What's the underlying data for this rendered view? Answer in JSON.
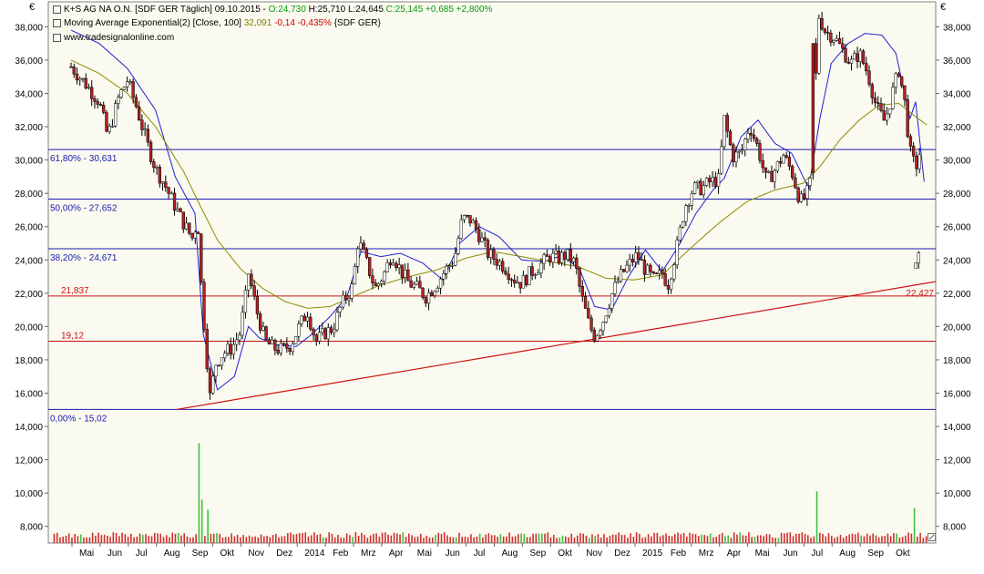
{
  "header": {
    "line1_instrument": "K+S AG NA O.N. [SDF GER  Täglich] 09.10.2015 - ",
    "line1_open": "O:24,730",
    "line1_high": "H:25,710",
    "line1_low": "L:24,645",
    "line1_close": "C:25,145 +0,685 +2,800%",
    "line2_name": "Moving Average Exponential(2) [Close, 100]",
    "line2_value": "32,091",
    "line2_change": "-0,14 -0,435%",
    "line2_source": "{SDF GER}",
    "line3": "www.tradesignalonline.com"
  },
  "currency_symbol": "€",
  "colors": {
    "background": "#fafaf0",
    "candle_up": "#ffffff",
    "candle_down": "#b22222",
    "bollinger": "#1f1fd6",
    "moving_average": "#8b8b00",
    "fibonacci": "#1a1ab0",
    "support": "#cc1111",
    "volume": "#d03030",
    "volume_green": "#40c040"
  },
  "chart_data": {
    "type": "candlestick",
    "series_info": "K+S AG NA O.N. daily",
    "ylim": [
      7000,
      39500
    ],
    "y_ticks": [
      "38,000",
      "36,000",
      "34,000",
      "32,000",
      "30,000",
      "28,000",
      "26,000",
      "24,000",
      "22,000",
      "20,000",
      "18,000",
      "16,000",
      "14,000",
      "12,000",
      "10,000",
      "8,000"
    ],
    "y_tick_values": [
      38,
      36,
      34,
      32,
      30,
      28,
      26,
      24,
      22,
      20,
      18,
      16,
      14,
      12,
      10,
      8
    ],
    "x_labels": [
      "Mai",
      "Jun",
      "Jul",
      "Aug",
      "Sep",
      "Okt",
      "Nov",
      "Dez",
      "2014",
      "Feb",
      "Mrz",
      "Apr",
      "Mai",
      "Jun",
      "Jul",
      "Aug",
      "Sep",
      "Okt",
      "Nov",
      "Dez",
      "2015",
      "Feb",
      "Mrz",
      "Apr",
      "Mai",
      "Jun",
      "Jul",
      "Aug",
      "Sep",
      "Okt"
    ],
    "fibonacci_levels": [
      {
        "label": "61,80% - 30,631",
        "value": 30.631
      },
      {
        "label": "50,00% - 27,652",
        "value": 27.652
      },
      {
        "label": "38,20% - 24,671",
        "value": 24.671
      },
      {
        "label": "0,00% - 15,02",
        "value": 15.02
      }
    ],
    "support_levels": [
      {
        "label": "21,837",
        "value": 21.837
      },
      {
        "label": "19,12",
        "value": 19.12
      }
    ],
    "trendline": {
      "start_month": 3.75,
      "start_value": 15.02,
      "end_month": 30.2,
      "end_value": 22.7,
      "label": "22,427"
    },
    "price_path": [
      [
        0,
        35.6
      ],
      [
        0.5,
        34.6
      ],
      [
        1,
        33.5
      ],
      [
        1.3,
        31.4
      ],
      [
        1.7,
        33.8
      ],
      [
        2,
        34.8
      ],
      [
        2.3,
        33.3
      ],
      [
        2.7,
        31.0
      ],
      [
        3.0,
        29.5
      ],
      [
        3.3,
        28.6
      ],
      [
        3.7,
        27.2
      ],
      [
        4.0,
        26.2
      ],
      [
        4.3,
        25.3
      ],
      [
        4.5,
        26.4
      ],
      [
        4.6,
        23.0
      ],
      [
        4.8,
        18.5
      ],
      [
        4.95,
        15.5
      ],
      [
        5.1,
        17.7
      ],
      [
        5.4,
        18.4
      ],
      [
        5.7,
        18.7
      ],
      [
        6.0,
        19.6
      ],
      [
        6.2,
        21.8
      ],
      [
        6.3,
        23.2
      ],
      [
        6.6,
        20.9
      ],
      [
        6.9,
        19.1
      ],
      [
        7.2,
        18.7
      ],
      [
        7.5,
        18.6
      ],
      [
        7.8,
        18.9
      ],
      [
        8.1,
        20.0
      ],
      [
        8.4,
        20.9
      ],
      [
        8.7,
        19.1
      ],
      [
        9.0,
        19.6
      ],
      [
        9.3,
        19.9
      ],
      [
        9.6,
        21.3
      ],
      [
        10.0,
        22.4
      ],
      [
        10.2,
        25.2
      ],
      [
        10.5,
        23.8
      ],
      [
        10.8,
        22.3
      ],
      [
        11.1,
        23.1
      ],
      [
        11.4,
        24.4
      ],
      [
        11.7,
        23.4
      ],
      [
        12.0,
        22.6
      ],
      [
        12.3,
        22.3
      ],
      [
        12.6,
        21.8
      ],
      [
        13.0,
        22.6
      ],
      [
        13.3,
        23.4
      ],
      [
        13.6,
        24.0
      ],
      [
        13.9,
        26.5
      ],
      [
        14.2,
        26.4
      ],
      [
        14.5,
        25.5
      ],
      [
        14.8,
        24.4
      ],
      [
        15.1,
        24.0
      ],
      [
        15.4,
        23.6
      ],
      [
        15.7,
        22.9
      ],
      [
        16.0,
        22.6
      ],
      [
        16.3,
        23.2
      ],
      [
        16.6,
        23.6
      ],
      [
        17.0,
        24.2
      ],
      [
        17.3,
        24.1
      ],
      [
        17.6,
        24.3
      ],
      [
        17.9,
        23.8
      ],
      [
        18.1,
        22.0
      ],
      [
        18.4,
        20.1
      ],
      [
        18.6,
        19.4
      ],
      [
        18.9,
        20.4
      ],
      [
        19.2,
        21.9
      ],
      [
        19.5,
        23.0
      ],
      [
        19.8,
        23.7
      ],
      [
        20.1,
        24.3
      ],
      [
        20.4,
        23.4
      ],
      [
        20.7,
        22.8
      ],
      [
        21.0,
        23.2
      ],
      [
        21.2,
        22.5
      ],
      [
        21.5,
        24.6
      ],
      [
        21.8,
        27.2
      ],
      [
        22.1,
        28.3
      ],
      [
        22.4,
        28.3
      ],
      [
        22.7,
        28.7
      ],
      [
        23.0,
        28.8
      ],
      [
        23.2,
        32.5
      ],
      [
        23.5,
        30.2
      ],
      [
        23.8,
        30.4
      ],
      [
        24.1,
        32.1
      ],
      [
        24.4,
        30.7
      ],
      [
        24.7,
        28.7
      ],
      [
        25.0,
        29.4
      ],
      [
        25.3,
        30.3
      ],
      [
        25.6,
        29.3
      ],
      [
        25.9,
        27.5
      ],
      [
        26.1,
        27.8
      ],
      [
        26.4,
        29.3
      ],
      [
        26.5,
        38.9
      ],
      [
        26.8,
        37.7
      ],
      [
        27.1,
        37.4
      ],
      [
        27.4,
        36.6
      ],
      [
        27.7,
        35.8
      ],
      [
        28.0,
        36.4
      ],
      [
        28.3,
        35.2
      ],
      [
        28.6,
        33.2
      ],
      [
        28.9,
        32.3
      ],
      [
        29.2,
        34.2
      ],
      [
        29.4,
        35.4
      ],
      [
        29.6,
        33.6
      ],
      [
        29.8,
        30.5
      ],
      [
        30.0,
        29.5
      ],
      [
        30.2,
        30.8
      ]
    ],
    "gap_path": [
      [
        30.0,
        23.5
      ],
      [
        30.2,
        24.5
      ]
    ],
    "bollinger_path": [
      [
        0,
        37.8
      ],
      [
        1,
        37.0
      ],
      [
        2,
        35.5
      ],
      [
        3,
        33.0
      ],
      [
        3.7,
        29.0
      ],
      [
        4.4,
        26.8
      ],
      [
        4.7,
        19.5
      ],
      [
        5.2,
        16.2
      ],
      [
        5.8,
        17.0
      ],
      [
        6.3,
        20.0
      ],
      [
        6.7,
        19.3
      ],
      [
        7.3,
        18.9
      ],
      [
        8.0,
        18.8
      ],
      [
        8.6,
        19.6
      ],
      [
        9.2,
        20.6
      ],
      [
        9.8,
        21.8
      ],
      [
        10.3,
        24.5
      ],
      [
        11.0,
        24.2
      ],
      [
        11.7,
        24.4
      ],
      [
        12.5,
        23.8
      ],
      [
        13.2,
        22.8
      ],
      [
        13.8,
        25.0
      ],
      [
        14.5,
        26.0
      ],
      [
        15.2,
        25.4
      ],
      [
        16.0,
        24.0
      ],
      [
        16.8,
        23.9
      ],
      [
        17.5,
        24.3
      ],
      [
        18.1,
        23.3
      ],
      [
        18.6,
        21.2
      ],
      [
        19.2,
        21.0
      ],
      [
        19.8,
        23.0
      ],
      [
        20.4,
        24.6
      ],
      [
        21.0,
        23.3
      ],
      [
        21.6,
        24.9
      ],
      [
        22.2,
        26.8
      ],
      [
        22.8,
        28.2
      ],
      [
        23.2,
        28.9
      ],
      [
        23.8,
        31.4
      ],
      [
        24.4,
        32.4
      ],
      [
        25.0,
        31.0
      ],
      [
        25.6,
        30.4
      ],
      [
        26.2,
        28.3
      ],
      [
        26.6,
        32.5
      ],
      [
        27.0,
        35.8
      ],
      [
        27.6,
        37.0
      ],
      [
        28.2,
        37.6
      ],
      [
        28.8,
        37.5
      ],
      [
        29.3,
        36.4
      ],
      [
        29.8,
        32.5
      ],
      [
        30.0,
        33.5
      ],
      [
        30.3,
        28.7
      ]
    ],
    "ma_path": [
      [
        0,
        36.0
      ],
      [
        1,
        35.2
      ],
      [
        2,
        34.0
      ],
      [
        3,
        32.0
      ],
      [
        4,
        29.3
      ],
      [
        4.6,
        27.2
      ],
      [
        5.2,
        25.2
      ],
      [
        6.0,
        23.5
      ],
      [
        6.8,
        22.3
      ],
      [
        7.6,
        21.5
      ],
      [
        8.4,
        21.1
      ],
      [
        9.2,
        21.2
      ],
      [
        10.0,
        21.8
      ],
      [
        11.0,
        22.5
      ],
      [
        12.0,
        23.0
      ],
      [
        13.0,
        23.4
      ],
      [
        14.0,
        24.1
      ],
      [
        15.0,
        24.5
      ],
      [
        16.0,
        24.2
      ],
      [
        17.0,
        23.9
      ],
      [
        18.0,
        23.6
      ],
      [
        19.0,
        22.9
      ],
      [
        20.0,
        22.8
      ],
      [
        21.0,
        23.1
      ],
      [
        22.0,
        24.7
      ],
      [
        23.0,
        26.2
      ],
      [
        24.0,
        27.5
      ],
      [
        25.0,
        28.2
      ],
      [
        26.0,
        28.6
      ],
      [
        26.6,
        29.6
      ],
      [
        27.3,
        31.2
      ],
      [
        28.0,
        32.4
      ],
      [
        28.7,
        33.3
      ],
      [
        29.4,
        33.4
      ],
      [
        30.0,
        32.6
      ],
      [
        30.4,
        32.1
      ]
    ],
    "volume_spikes": [
      {
        "month": 4.5,
        "value": 13.0
      },
      {
        "month": 4.7,
        "value": 9.6
      },
      {
        "month": 4.9,
        "value": 9.0
      },
      {
        "month": 26.5,
        "value": 10.1
      },
      {
        "month": 30.0,
        "value": 9.1
      }
    ],
    "volume_baseline": 7.3
  }
}
